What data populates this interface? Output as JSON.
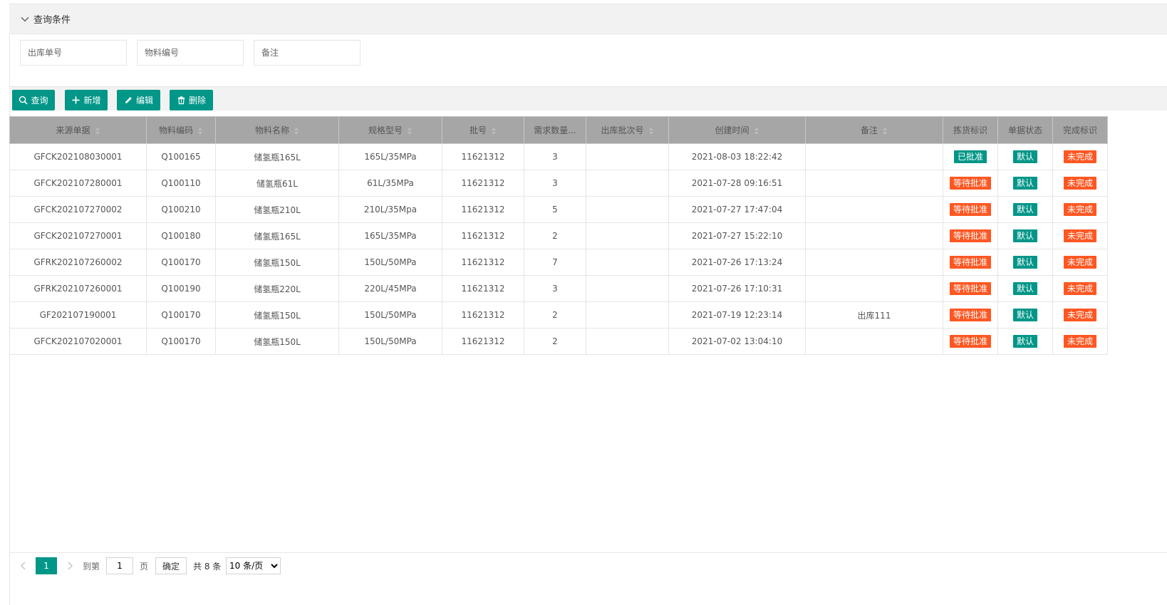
{
  "query": {
    "title": "查询条件",
    "fields": [
      {
        "placeholder": "出库单号"
      },
      {
        "placeholder": "物料编号"
      },
      {
        "placeholder": "备注"
      }
    ]
  },
  "toolbar": {
    "search_label": "查询",
    "add_label": "新增",
    "edit_label": "编辑",
    "delete_label": "删除"
  },
  "table": {
    "headers": [
      "来源单据",
      "物料编码",
      "物料名称",
      "规格型号",
      "批号",
      "需求数量...",
      "出库批次号",
      "创建时间",
      "备注",
      "拣货标识",
      "单据状态",
      "完成标识"
    ],
    "rows": [
      {
        "source": "GFCK202108030001",
        "code": "Q100165",
        "name": "储氢瓶165L",
        "spec": "165L/35MPa",
        "batch": "11621312",
        "qty": "3",
        "out_batch": "",
        "created": "2021-08-03 18:22:42",
        "remark": "",
        "pick": "已批准",
        "status": "默认",
        "done": "未完成"
      },
      {
        "source": "GFCK202107280001",
        "code": "Q100110",
        "name": "储氢瓶61L",
        "spec": "61L/35MPa",
        "batch": "11621312",
        "qty": "3",
        "out_batch": "",
        "created": "2021-07-28 09:16:51",
        "remark": "",
        "pick": "等待批准",
        "status": "默认",
        "done": "未完成"
      },
      {
        "source": "GFCK202107270002",
        "code": "Q100210",
        "name": "储氢瓶210L",
        "spec": "210L/35Mpa",
        "batch": "11621312",
        "qty": "5",
        "out_batch": "",
        "created": "2021-07-27 17:47:04",
        "remark": "",
        "pick": "等待批准",
        "status": "默认",
        "done": "未完成"
      },
      {
        "source": "GFCK202107270001",
        "code": "Q100180",
        "name": "储氢瓶165L",
        "spec": "165L/35MPa",
        "batch": "11621312",
        "qty": "2",
        "out_batch": "",
        "created": "2021-07-27 15:22:10",
        "remark": "",
        "pick": "等待批准",
        "status": "默认",
        "done": "未完成"
      },
      {
        "source": "GFRK202107260002",
        "code": "Q100170",
        "name": "储氢瓶150L",
        "spec": "150L/50MPa",
        "batch": "11621312",
        "qty": "7",
        "out_batch": "",
        "created": "2021-07-26 17:13:24",
        "remark": "",
        "pick": "等待批准",
        "status": "默认",
        "done": "未完成"
      },
      {
        "source": "GFRK202107260001",
        "code": "Q100190",
        "name": "储氢瓶220L",
        "spec": "220L/45MPa",
        "batch": "11621312",
        "qty": "3",
        "out_batch": "",
        "created": "2021-07-26 17:10:31",
        "remark": "",
        "pick": "等待批准",
        "status": "默认",
        "done": "未完成"
      },
      {
        "source": "GF202107190001",
        "code": "Q100170",
        "name": "储氢瓶150L",
        "spec": "150L/50MPa",
        "batch": "11621312",
        "qty": "2",
        "out_batch": "",
        "created": "2021-07-19 12:23:14",
        "remark": "出库111",
        "pick": "等待批准",
        "status": "默认",
        "done": "未完成"
      },
      {
        "source": "GFCK202107020001",
        "code": "Q100170",
        "name": "储氢瓶150L",
        "spec": "150L/50MPa",
        "batch": "11621312",
        "qty": "2",
        "out_batch": "",
        "created": "2021-07-02 13:04:10",
        "remark": "",
        "pick": "等待批准",
        "status": "默认",
        "done": "未完成"
      }
    ]
  },
  "badge_colors": {
    "已批准": "#009688",
    "等待批准": "#FF5722",
    "默认": "#009688",
    "未完成": "#FF5722"
  },
  "pager": {
    "current_page": "1",
    "goto_label": "到第",
    "page_value": "1",
    "page_label": "页",
    "confirm_label": "确定",
    "total_label": "共 8 条",
    "page_size": "10 条/页"
  },
  "colors": {
    "accent": "#009688",
    "warning": "#FF5722",
    "header_bg": "#a6a6a6"
  }
}
